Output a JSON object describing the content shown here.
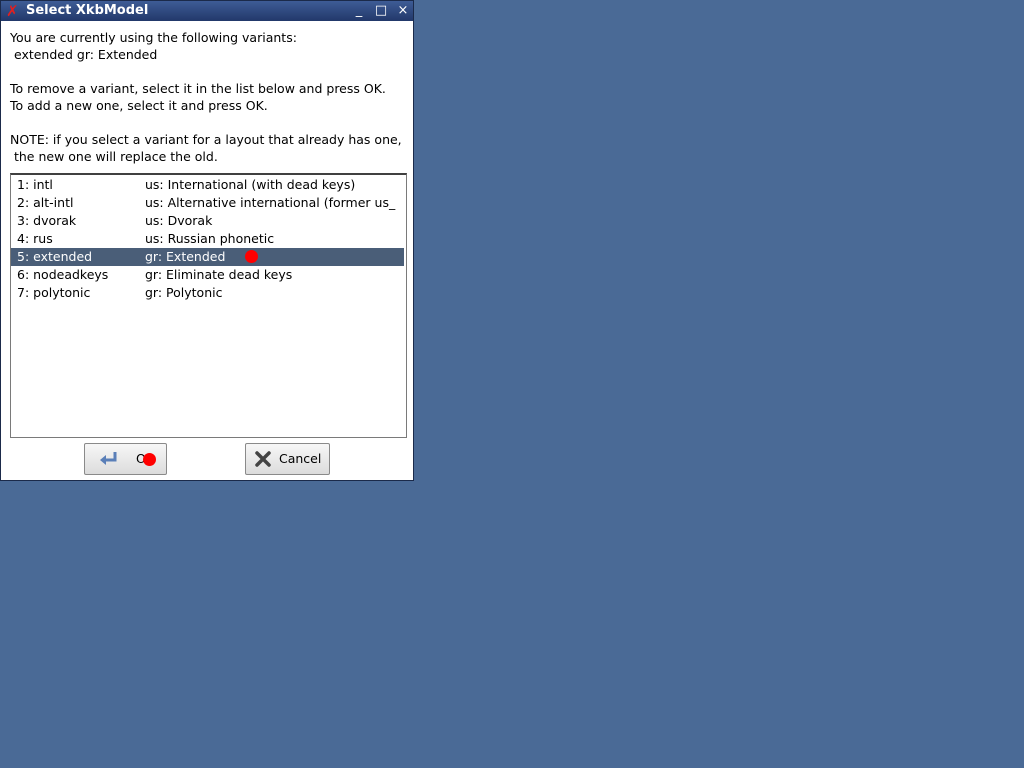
{
  "window": {
    "title": "Select XkbModel",
    "minimize_symbol": "_",
    "maximize_symbol": "□",
    "close_symbol": "×"
  },
  "message": {
    "line1": "You are currently using the following variants:",
    "line2": " extended gr: Extended",
    "line3": "To remove a variant, select it in the list below and press OK.",
    "line4": "To add a new one, select it and press OK.",
    "line5": "NOTE: if you select a variant for a layout that already has one,",
    "line6": " the new one will replace the old."
  },
  "variants": [
    {
      "id": "1: intl",
      "desc": "us: International (with dead keys)"
    },
    {
      "id": "2: alt-intl",
      "desc": "us: Alternative international (former us_"
    },
    {
      "id": "3: dvorak",
      "desc": "us: Dvorak"
    },
    {
      "id": "4: rus",
      "desc": "us: Russian phonetic"
    },
    {
      "id": "5: extended",
      "desc": "gr: Extended"
    },
    {
      "id": "6: nodeadkeys",
      "desc": "gr: Eliminate dead keys"
    },
    {
      "id": "7: polytonic",
      "desc": "gr: Polytonic"
    }
  ],
  "selected_index": 4,
  "buttons": {
    "ok_label": "O",
    "cancel_label": "Cancel"
  },
  "colors": {
    "selection": "#4a5e78",
    "marker": "#ff0000",
    "title_accent": "#e02020"
  },
  "icons": {
    "title": "x-close-icon",
    "ok": "enter-arrow-icon",
    "cancel": "x-mark-icon"
  }
}
